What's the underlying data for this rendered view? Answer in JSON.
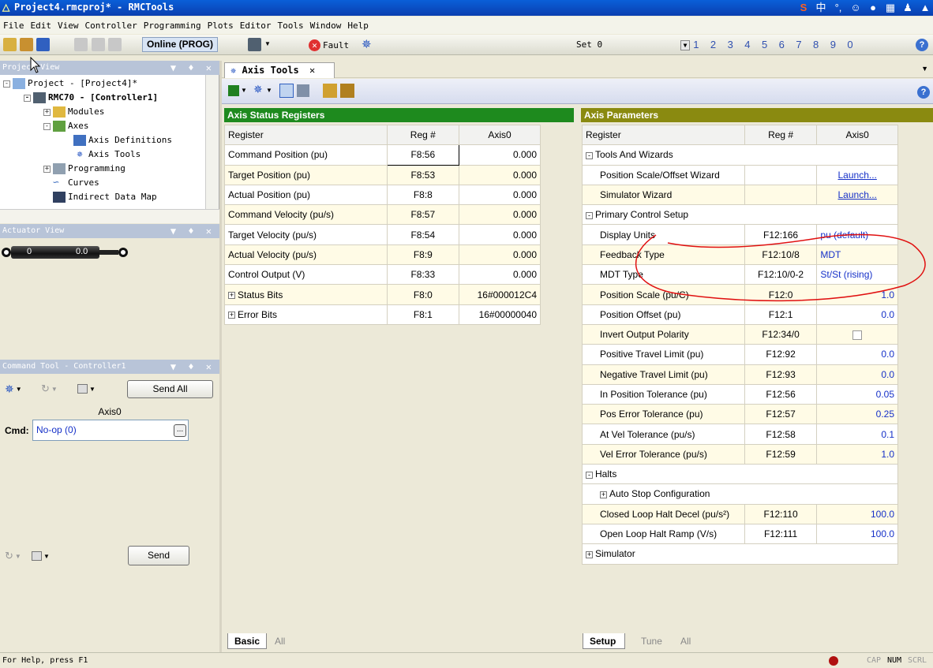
{
  "window": {
    "title": "Project4.rmcproj* - RMCTools"
  },
  "menu": [
    "File",
    "Edit",
    "View",
    "Controller",
    "Programming",
    "Plots",
    "Editor",
    "Tools",
    "Window",
    "Help"
  ],
  "toolbar": {
    "mode": "Online (PROG)",
    "fault": "Fault",
    "set_label": "Set 0",
    "numbers": [
      "1",
      "2",
      "3",
      "4",
      "5",
      "6",
      "7",
      "8",
      "9",
      "0"
    ]
  },
  "project_view": {
    "title": "Project View",
    "items": [
      {
        "label": "Project - [Project4]*"
      },
      {
        "label": "RMC70 - [Controller1]"
      },
      {
        "label": "Modules"
      },
      {
        "label": "Axes"
      },
      {
        "label": "Axis Definitions"
      },
      {
        "label": "Axis Tools"
      },
      {
        "label": "Programming"
      },
      {
        "label": "Curves"
      },
      {
        "label": "Indirect Data Map"
      }
    ]
  },
  "actuator_view": {
    "title": "Actuator View",
    "left_value": "0",
    "right_value": "0.0"
  },
  "command_tool": {
    "title": "Command Tool - Controller1",
    "send_all": "Send All",
    "axis_label": "Axis0",
    "cmd_label": "Cmd:",
    "cmd_value": "No-op (0)",
    "browse": "...",
    "send": "Send"
  },
  "doc_tab": {
    "label": "Axis Tools"
  },
  "status_registers": {
    "title": "Axis Status Registers",
    "columns": [
      "Register",
      "Reg #",
      "Axis0"
    ],
    "rows": [
      {
        "register": "Command Position (pu)",
        "reg": "F8:56",
        "value": "0.000"
      },
      {
        "register": "Target Position (pu)",
        "reg": "F8:53",
        "value": "0.000"
      },
      {
        "register": "Actual Position (pu)",
        "reg": "F8:8",
        "value": "0.000"
      },
      {
        "register": "Command Velocity (pu/s)",
        "reg": "F8:57",
        "value": "0.000"
      },
      {
        "register": "Target Velocity (pu/s)",
        "reg": "F8:54",
        "value": "0.000"
      },
      {
        "register": "Actual Velocity (pu/s)",
        "reg": "F8:9",
        "value": "0.000"
      },
      {
        "register": "Control Output (V)",
        "reg": "F8:33",
        "value": "0.000"
      },
      {
        "register": "Status Bits",
        "reg": "F8:0",
        "value": "16#000012C4"
      },
      {
        "register": "Error Bits",
        "reg": "F8:1",
        "value": "16#00000040"
      }
    ],
    "tabs": [
      "Basic",
      "All"
    ]
  },
  "axis_parameters": {
    "title": "Axis Parameters",
    "columns": [
      "Register",
      "Reg #",
      "Axis0"
    ],
    "rows": [
      {
        "register": "Tools And Wizards",
        "reg": "",
        "value": ""
      },
      {
        "register": "Position Scale/Offset Wizard",
        "reg": "",
        "value": "Launch..."
      },
      {
        "register": "Simulator Wizard",
        "reg": "",
        "value": "Launch..."
      },
      {
        "register": "Primary Control Setup",
        "reg": "",
        "value": ""
      },
      {
        "register": "Display Units",
        "reg": "F12:166",
        "value": "pu (default)"
      },
      {
        "register": "Feedback Type",
        "reg": "F12:10/8",
        "value": "MDT"
      },
      {
        "register": "MDT Type",
        "reg": "F12:10/0-2",
        "value": "St/St (rising)"
      },
      {
        "register": "Position Scale (pu/C)",
        "reg": "F12:0",
        "value": "1.0"
      },
      {
        "register": "Position Offset (pu)",
        "reg": "F12:1",
        "value": "0.0"
      },
      {
        "register": "Invert Output Polarity",
        "reg": "F12:34/0",
        "value": ""
      },
      {
        "register": "Positive Travel Limit (pu)",
        "reg": "F12:92",
        "value": "0.0"
      },
      {
        "register": "Negative Travel Limit (pu)",
        "reg": "F12:93",
        "value": "0.0"
      },
      {
        "register": "In Position Tolerance (pu)",
        "reg": "F12:56",
        "value": "0.05"
      },
      {
        "register": "Pos Error Tolerance (pu)",
        "reg": "F12:57",
        "value": "0.25"
      },
      {
        "register": "At Vel Tolerance (pu/s)",
        "reg": "F12:58",
        "value": "0.1"
      },
      {
        "register": "Vel Error Tolerance (pu/s)",
        "reg": "F12:59",
        "value": "1.0"
      },
      {
        "register": "Halts",
        "reg": "",
        "value": ""
      },
      {
        "register": "Auto Stop Configuration",
        "reg": "",
        "value": ""
      },
      {
        "register": "Closed Loop Halt Decel (pu/s²)",
        "reg": "F12:110",
        "value": "100.0"
      },
      {
        "register": "Open Loop Halt Ramp (V/s)",
        "reg": "F12:111",
        "value": "100.0"
      },
      {
        "register": "Simulator",
        "reg": "",
        "value": ""
      }
    ],
    "tabs": [
      "Setup",
      "Tune",
      "All"
    ]
  },
  "status_bar": {
    "help": "For Help, press F1",
    "indicators": [
      "CAP",
      "NUM",
      "SCRL"
    ]
  },
  "colors": {
    "status_header": "#1e8a1e",
    "params_header": "#8a8a10",
    "title_bar": "#0a4fc8",
    "annotation": "#e01010"
  }
}
